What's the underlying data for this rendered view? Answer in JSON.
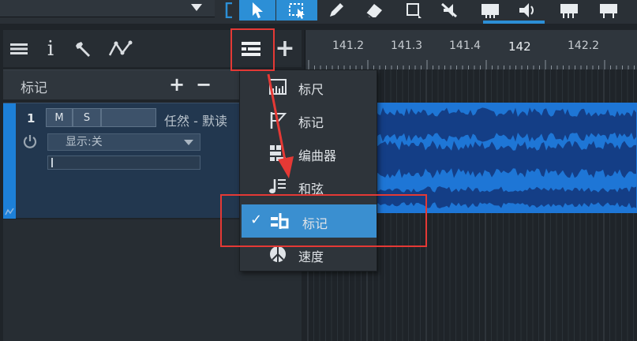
{
  "marker_panel": {
    "title": "标记",
    "add_label": "+",
    "remove_label": "−"
  },
  "header_icons": {
    "list": "list-icon",
    "info_label": "i",
    "wrench": "wrench-icon",
    "automation": "automation-icon",
    "track_list": "track-list-icon",
    "add_label": "+"
  },
  "track": {
    "number": "1",
    "mute_label": "M",
    "solo_label": "S",
    "name": "任然 - 默读",
    "display_select": "显示:关"
  },
  "ruler": {
    "labels": [
      "141.2",
      "141.3",
      "141.4",
      "142",
      "142.2"
    ]
  },
  "menu": {
    "items": [
      {
        "label": "标尺",
        "icon": "ruler-icon"
      },
      {
        "label": "标记",
        "icon": "marker-flag-icon"
      },
      {
        "label": "编曲器",
        "icon": "arranger-icon"
      },
      {
        "label": "和弦",
        "icon": "chord-icon"
      },
      {
        "label": "标记",
        "icon": "marker-track-icon",
        "checked": true
      },
      {
        "label": "速度",
        "icon": "tempo-icon"
      }
    ],
    "check_mark": "✓"
  },
  "colors": {
    "accent": "#2c8fd6",
    "clip": "#1e76d6",
    "waveform": "#143e86",
    "menu_selected": "#3a8fd0",
    "annotation": "#e53935"
  }
}
